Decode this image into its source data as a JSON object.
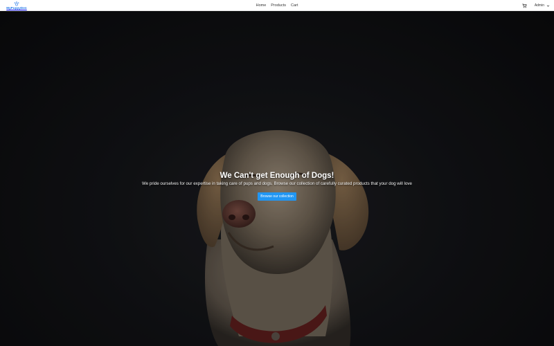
{
  "navbar": {
    "brand": "MyPuppyDen",
    "brand_icon": "paw-logo-icon",
    "links": [
      {
        "label": "Home"
      },
      {
        "label": "Products"
      },
      {
        "label": "Cart"
      }
    ],
    "cart_icon": "cart-icon",
    "user": {
      "label": "Admin",
      "icon": "chevron-down-icon"
    }
  },
  "hero": {
    "title": "We Can't get Enough of Dogs!",
    "subtitle": "We pride ourselves for our expertise in taking care of pups and dogs. Browse our collection of carefully curated products that your dog will love",
    "cta_label": "Browse our collection"
  },
  "colors": {
    "accent": "#2196f3",
    "brand": "#1a73e8",
    "hero_background": "#0b0b0d"
  }
}
